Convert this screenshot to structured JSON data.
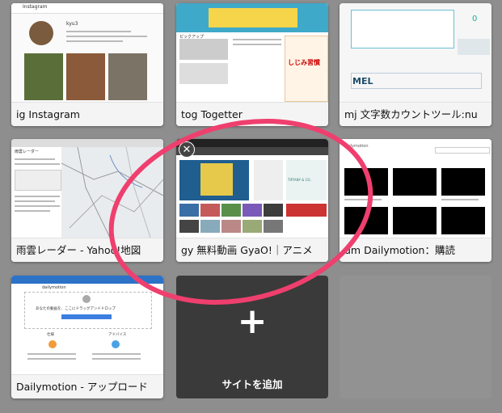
{
  "tiles": [
    {
      "caption": "ig Instagram"
    },
    {
      "caption": "tog Togetter"
    },
    {
      "caption": "mj 文字数カウントツール:nu"
    },
    {
      "caption": "雨雲レーダー - Yahoo!地図"
    },
    {
      "caption": "gy 無料動画 GyaO!｜アニメ"
    },
    {
      "caption": "dm Dailymotion：購読"
    },
    {
      "caption": "Dailymotion - アップロード"
    }
  ],
  "add_site": {
    "plus": "+",
    "label": "サイトを追加"
  },
  "close_glyph": "✕",
  "thumbs": {
    "instagram": {
      "logo": "Instagram",
      "user": "kyu3"
    },
    "togetter": {
      "promo": "しじみ習慣",
      "badge": "ピックアップ"
    },
    "mojicount": {
      "brand": "MEL",
      "count": "0"
    },
    "yahoo_map": {
      "title": "雨雲レーダー"
    },
    "gyao": {
      "brand": "TIFFANY & CO."
    },
    "dailymotion": {
      "logo": "dailymotion"
    },
    "upload": {
      "logo": "dailymotion",
      "drop_text": "あなたの動画を、ここにドラッグアンドドロップ",
      "col1": "仕様",
      "col2": "アドバイス"
    }
  },
  "colors": {
    "highlight_ring": "#ef3f6e",
    "add_tile_bg": "#3a3a3a",
    "page_bg": "#8e8e8e"
  }
}
